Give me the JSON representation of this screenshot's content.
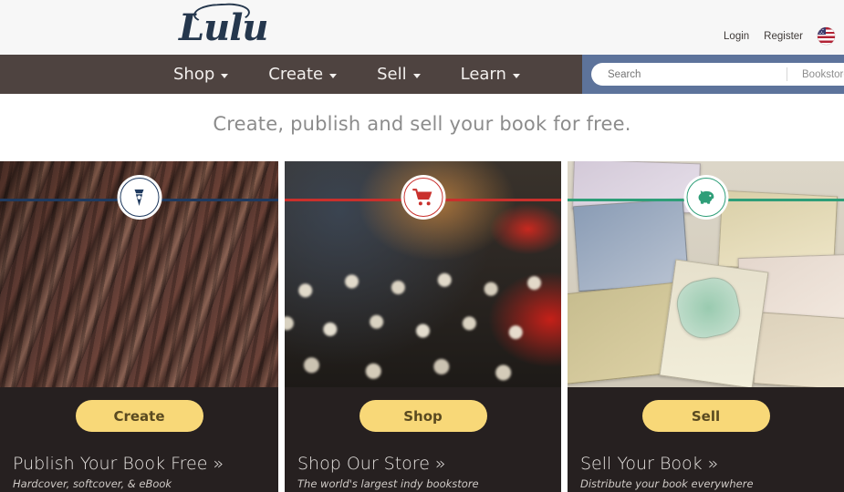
{
  "header": {
    "logo_text": "Lulu",
    "logo_name": "lulu-logo",
    "login_label": "Login",
    "register_label": "Register",
    "locale_flag": "us-flag-icon"
  },
  "nav": {
    "items": [
      {
        "label": "Shop"
      },
      {
        "label": "Create"
      },
      {
        "label": "Sell"
      },
      {
        "label": "Learn"
      }
    ]
  },
  "search": {
    "placeholder": "Search",
    "value": "",
    "scope_label": "Bookstore"
  },
  "hero": {
    "tagline": "Create, publish and sell your book for free."
  },
  "panels": [
    {
      "badge_icon": "pen-nib-icon",
      "accent_color": "#1f3a5f",
      "photo": "letterpress-type-blocks",
      "button_label": "Create",
      "heading": "Publish Your Book Free »",
      "subtitle": "Hardcover, softcover, & eBook"
    },
    {
      "badge_icon": "shopping-cart-icon",
      "accent_color": "#c9302c",
      "photo": "vintage-typewriter-keys",
      "button_label": "Shop",
      "heading": "Shop Our Store »",
      "subtitle": "The world's largest indy bookstore"
    },
    {
      "badge_icon": "piggy-bank-icon",
      "accent_color": "#2e9e78",
      "photo": "world-currency-banknotes",
      "button_label": "Sell",
      "heading": "Sell Your Book »",
      "subtitle": "Distribute your book everywhere"
    }
  ],
  "colors": {
    "nav_bar": "#4e4340",
    "search_bar": "#5d739b",
    "panel_dark": "#262020",
    "cta_yellow": "#f8d878",
    "logo_navy": "#25374d",
    "tagline_gray": "#8c8c8c"
  }
}
